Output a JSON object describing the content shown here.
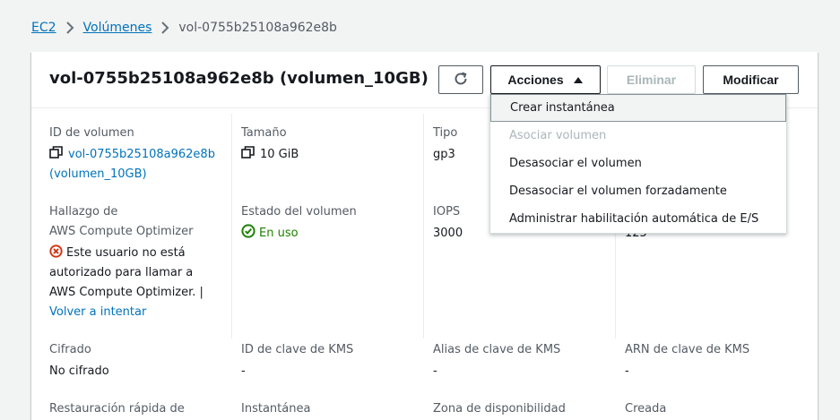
{
  "breadcrumb": {
    "item1": "EC2",
    "item2": "Volúmenes",
    "current": "vol-0755b25108a962e8b"
  },
  "header": {
    "title": "vol-0755b25108a962e8b (volumen_10GB)",
    "actions_label": "Acciones",
    "delete_label": "Eliminar",
    "modify_label": "Modificar"
  },
  "details": {
    "volume_id_label": "ID de volumen",
    "volume_id_value_line1": "vol-0755b25108a962e8b",
    "volume_id_value_line2": "(volumen_10GB)",
    "size_label": "Tamaño",
    "size_value": "10 GiB",
    "type_label": "Tipo",
    "type_value": "gp3",
    "throughput_value_partial": "125",
    "optimizer_label_line1": "Hallazgo de",
    "optimizer_label_line2": "AWS Compute Optimizer",
    "optimizer_error_line1": "Este usuario no está",
    "optimizer_error_line2": "autorizado para llamar a",
    "optimizer_error_line3": "AWS Compute Optimizer. |",
    "optimizer_retry": "Volver a intentar",
    "state_label": "Estado del volumen",
    "state_value": "En uso",
    "iops_label": "IOPS",
    "iops_value": "3000",
    "encryption_label": "Cifrado",
    "encryption_value": "No cifrado",
    "kms_id_label": "ID de clave de KMS",
    "kms_id_value": "-",
    "kms_alias_label": "Alias de clave de KMS",
    "kms_alias_value": "-",
    "kms_arn_label": "ARN de clave de KMS",
    "kms_arn_value": "-",
    "fast_restore_label": "Restauración rápida de",
    "snapshot_label": "Instantánea",
    "az_label": "Zona de disponibilidad",
    "created_label": "Creada"
  },
  "actions_menu": {
    "items": [
      "Crear instantánea",
      "Asociar volumen",
      "Desasociar el volumen",
      "Desasociar el volumen forzadamente",
      "Administrar habilitación automática de E/S"
    ]
  },
  "colors": {
    "link": "#0073bb",
    "success": "#1d8102",
    "error": "#d13212",
    "background": "#f2f3f3"
  }
}
